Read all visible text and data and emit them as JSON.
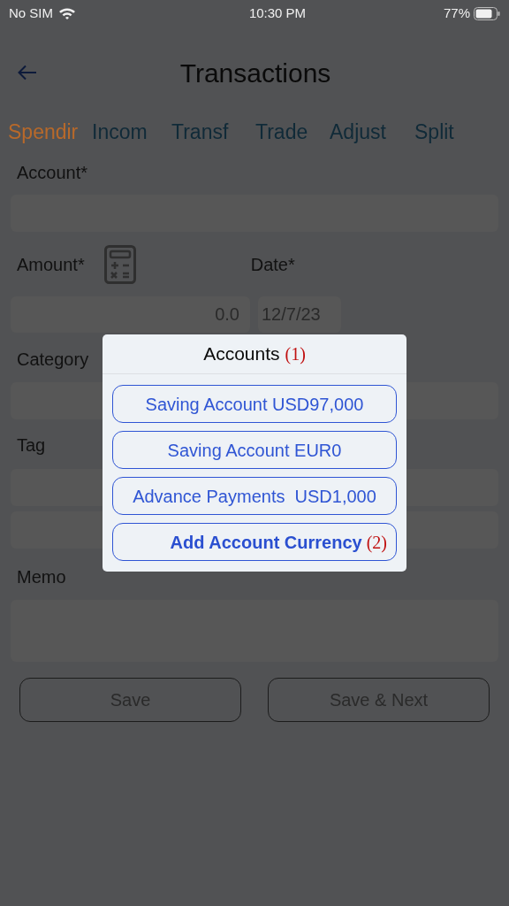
{
  "status_bar": {
    "carrier": "No SIM",
    "time": "10:30 PM",
    "battery": "77%"
  },
  "header": {
    "title": "Transactions"
  },
  "tabs": [
    {
      "label": "Spendir",
      "selected": true
    },
    {
      "label": "Incom",
      "selected": false
    },
    {
      "label": "Transf",
      "selected": false
    },
    {
      "label": "Trade",
      "selected": false
    },
    {
      "label": "Adjust",
      "selected": false
    },
    {
      "label": "Split",
      "selected": false
    }
  ],
  "form": {
    "account_label": "Account*",
    "amount_label": "Amount*",
    "amount_value": "0.0",
    "date_label": "Date*",
    "date_value": "12/7/23",
    "category_label": "Category",
    "tag_label": "Tag",
    "memo_label": "Memo"
  },
  "buttons": [
    "Save",
    "Save & Next"
  ],
  "dialog": {
    "title": "Accounts",
    "title_marker": "(1)",
    "options": [
      {
        "label": "Saving Account USD97,000",
        "kind": "account"
      },
      {
        "label": "Saving Account EUR0",
        "kind": "account"
      },
      {
        "label": "Advance Payments  USD1,000",
        "kind": "account"
      },
      {
        "label": "Add Account Currency",
        "kind": "add",
        "marker": "(2)"
      }
    ]
  }
}
